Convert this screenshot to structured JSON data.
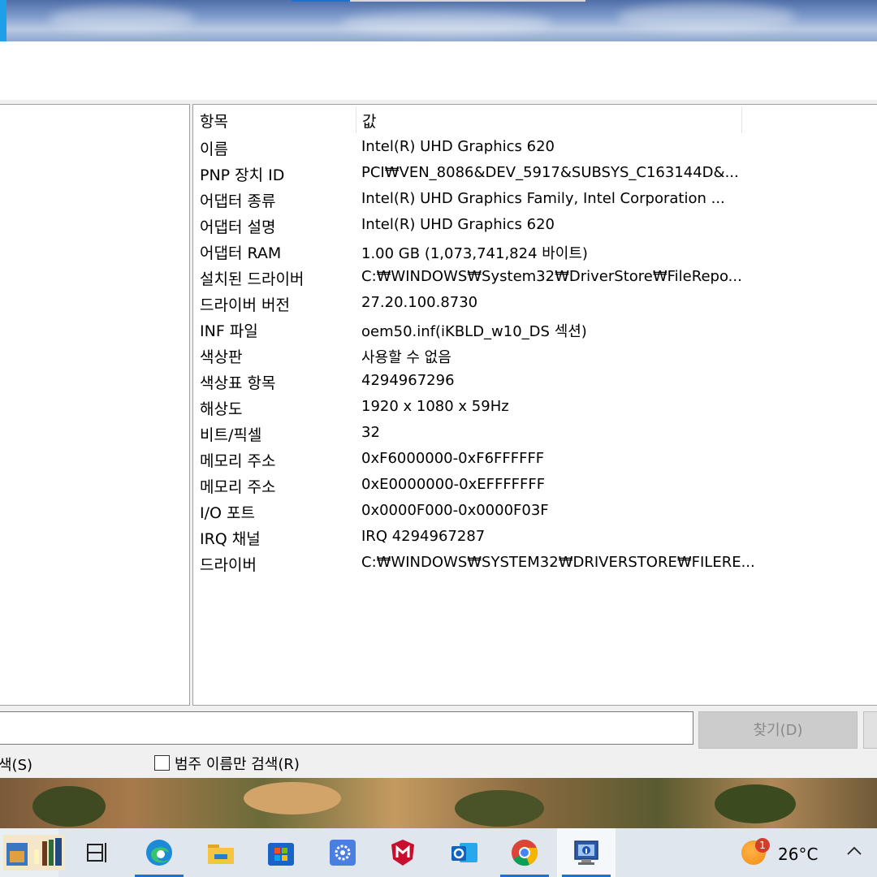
{
  "info_table": {
    "header_item": "항목",
    "header_value": "값",
    "rows": [
      {
        "key": "이름",
        "value": "Intel(R) UHD Graphics 620"
      },
      {
        "key": "PNP 장치 ID",
        "value": "PCI₩VEN_8086&DEV_5917&SUBSYS_C163144D&..."
      },
      {
        "key": "어댑터 종류",
        "value": "Intel(R) UHD Graphics Family, Intel Corporation ..."
      },
      {
        "key": "어댑터 설명",
        "value": "Intel(R) UHD Graphics 620"
      },
      {
        "key": "어댑터 RAM",
        "value": "1.00 GB (1,073,741,824 바이트)"
      },
      {
        "key": "설치된 드라이버",
        "value": "C:₩WINDOWS₩System32₩DriverStore₩FileRepo..."
      },
      {
        "key": "드라이버 버전",
        "value": "27.20.100.8730"
      },
      {
        "key": "INF 파일",
        "value": "oem50.inf(iKBLD_w10_DS 섹션)"
      },
      {
        "key": "색상판",
        "value": "사용할 수 없음"
      },
      {
        "key": "색상표 항목",
        "value": "4294967296"
      },
      {
        "key": "해상도",
        "value": "1920 x 1080 x 59Hz"
      },
      {
        "key": "비트/픽셀",
        "value": "32"
      },
      {
        "key": "메모리 주소",
        "value": "0xF6000000-0xF6FFFFFF"
      },
      {
        "key": "메모리 주소",
        "value": "0xE0000000-0xEFFFFFFF"
      },
      {
        "key": "I/O 포트",
        "value": "0x0000F000-0x0000F03F"
      },
      {
        "key": "IRQ 채널",
        "value": "IRQ 4294967287"
      },
      {
        "key": "드라이버",
        "value": "C:₩WINDOWS₩SYSTEM32₩DRIVERSTORE₩FILERE..."
      }
    ]
  },
  "search": {
    "value": "",
    "find_label": "찾기(D)",
    "option_left": "색(S)",
    "option_right": "범주 이름만 검색(R)"
  },
  "taskbar": {
    "items": [
      "desktop-thumbnail-icon",
      "task-view-icon",
      "edge-icon",
      "file-explorer-icon",
      "store-icon",
      "settings-icon",
      "mcafee-icon",
      "outlook-icon",
      "chrome-icon",
      "system-info-icon"
    ],
    "weather_badge": "1",
    "temperature": "26°C",
    "tray_chevron": "^"
  }
}
